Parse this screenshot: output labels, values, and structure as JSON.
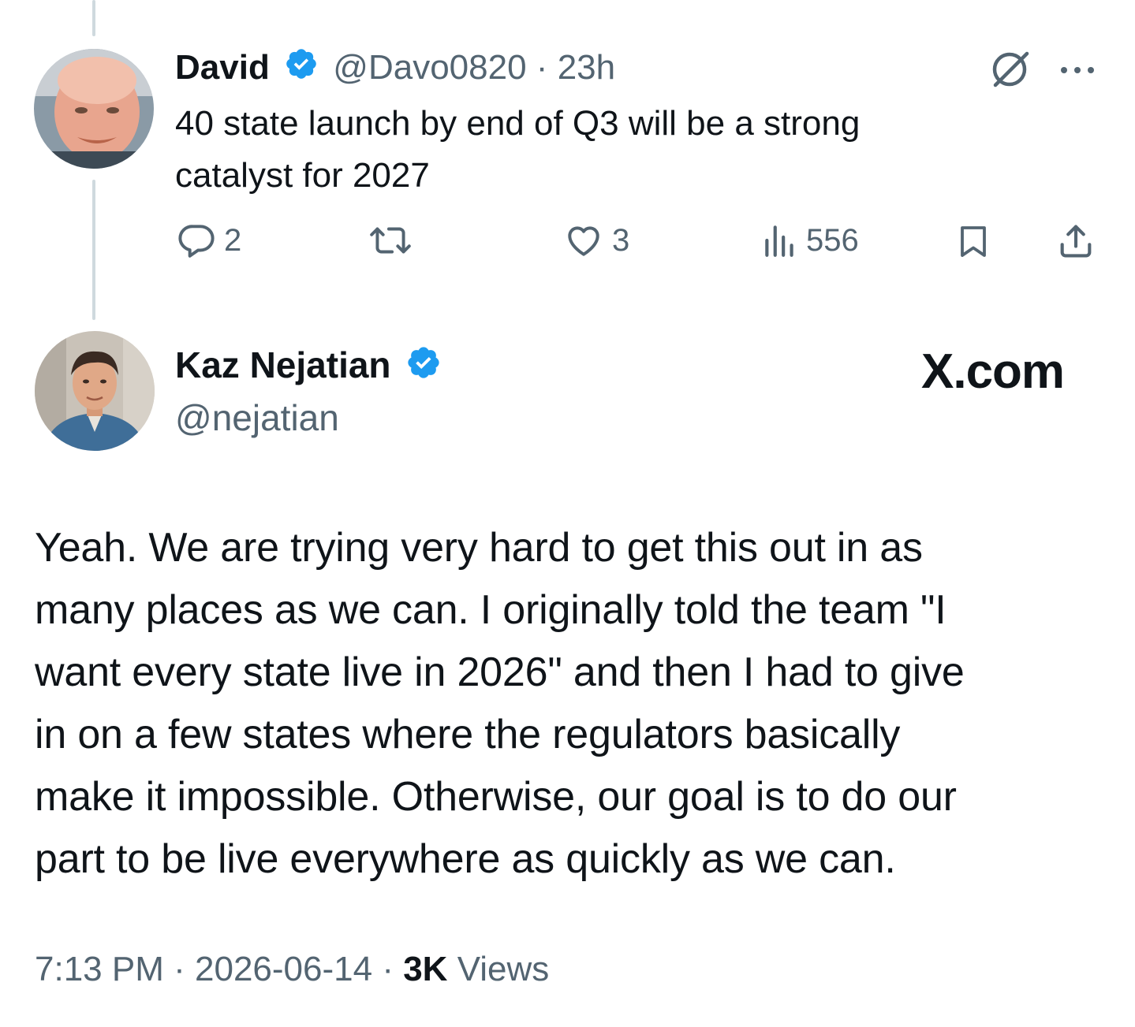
{
  "parent_tweet": {
    "name": "David",
    "handle": "@Davo0820",
    "separator": "·",
    "time": "23h",
    "text_line1": "40 state launch by end of Q3 will be a strong",
    "text_line2": "catalyst for 2027",
    "replies": "2",
    "likes": "3",
    "views": "556"
  },
  "main_tweet": {
    "name": "Kaz Nejatian",
    "handle": "@nejatian",
    "brand": "X.com",
    "lines": [
      "Yeah.  We are trying very hard to get this out in as",
      "many places as we can.  I originally told the team \"I",
      "want every state live in 2026\" and then I had to give",
      "in on a few states where the regulators basically",
      "make it impossible.  Otherwise, our goal is to do our",
      "part to be live everywhere as quickly as we can."
    ],
    "timestamp": "7:13 PM",
    "date": "2026-06-14",
    "sep": "·",
    "views_count": "3K",
    "views_label": "Views"
  },
  "colors": {
    "verified_blue": "#1d9bf0",
    "muted": "#536471",
    "thread_line": "#cfd9de"
  },
  "icons": [
    "verified-badge-icon",
    "grok-icon",
    "more-icon",
    "reply-icon",
    "retweet-icon",
    "like-icon",
    "views-icon",
    "bookmark-icon",
    "share-icon"
  ]
}
